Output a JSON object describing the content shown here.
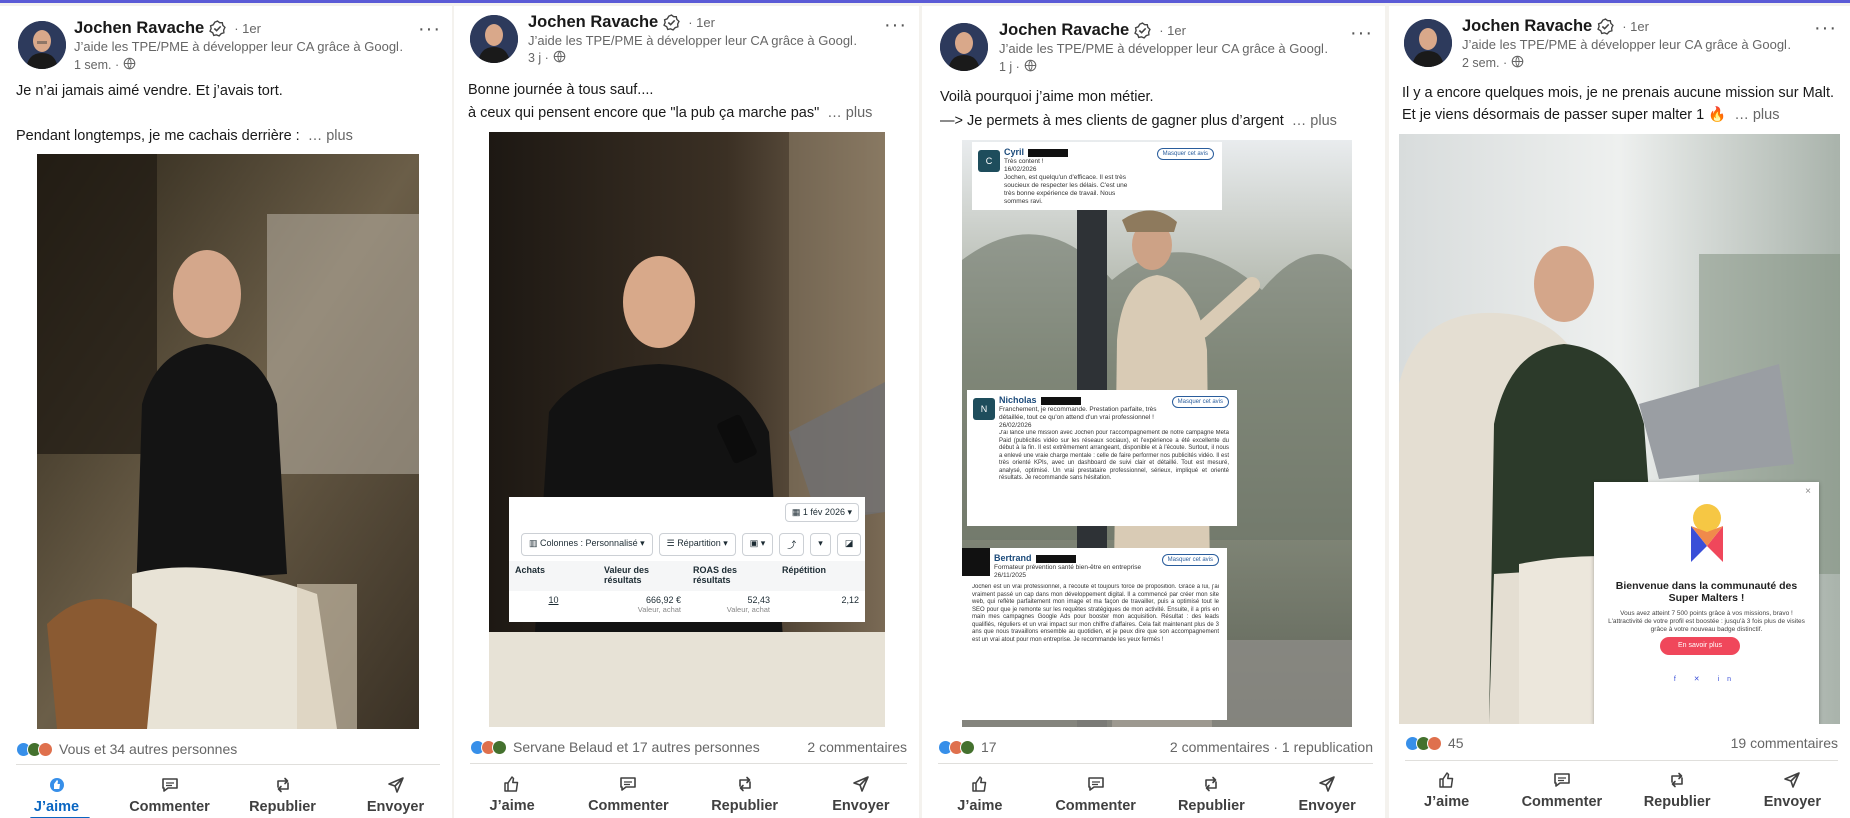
{
  "author": {
    "name": "Jochen Ravache",
    "degree": "· 1er",
    "tagline": "J’aide les TPE/PME à développer leur CA grâce à Googl…"
  },
  "more_label": "… plus",
  "actions": {
    "like": "J’aime",
    "comment": "Commenter",
    "repost": "Republier",
    "send": "Envoyer"
  },
  "colors": {
    "accent": "#0a66c2",
    "like_blue": "#378fe9"
  },
  "posts": [
    {
      "time": "1 sem. ·",
      "line1": "Je n’ai jamais aimé vendre. Et j’avais tort.",
      "line2": "Pendant longtemps, je me cachais derrière :",
      "reactions_text": "Vous et 34 autres personnes",
      "comments": "",
      "liked": true
    },
    {
      "time": "3 j ·",
      "line1": "Bonne journée à tous sauf....",
      "line2": "à ceux qui pensent encore que \"la pub ça marche pas\"",
      "reactions_text": "Servane Belaud et 17 autres personnes",
      "comments": "2 commentaires",
      "ads": {
        "date": "1 fév 2026",
        "columns_btn": "Colonnes : Personnalisé",
        "breakdown_btn": "Répartition",
        "headers": [
          "Achats",
          "Valeur des résultats",
          "ROAS des résultats",
          "Répétition"
        ],
        "values": [
          "10",
          "666,92 €",
          "52,43",
          "2,12"
        ],
        "subs": [
          "",
          "Valeur, achat",
          "Valeur, achat",
          ""
        ]
      }
    },
    {
      "time": "1 j ·",
      "line1": "Voilà pourquoi j’aime mon métier.",
      "line2": "—> Je permets à mes clients de gagner plus d’argent",
      "reactions_count": "17",
      "comments": "2 commentaires · 1 republication",
      "testimonials": [
        {
          "initial": "C",
          "name": "Cyril",
          "sub": "Très content !",
          "date": "16/02/2026",
          "body": "Jochen, est quelqu'un d'efficace. Il est très soucieux de respecter les délais. C'est une très bonne expérience de travail. Nous sommes ravi.",
          "mask": "Masquer cet avis"
        },
        {
          "initial": "N",
          "name": "Nicholas",
          "sub": "Franchement, je recommande. Prestation parfaite, très détaillée, tout ce qu'on attend d'un vrai professionnel !",
          "date": "26/02/2026",
          "body": "J'ai lancé une mission avec Jochen pour l'accompagnement de notre campagne Meta Paid (publicités vidéo sur les réseaux sociaux), et l'expérience a été excellente du début à la fin. Il est extrêmement arrangeant, disponible et à l'écoute. Surtout, il nous a enlevé une vraie charge mentale : celle de faire performer nos publicités vidéo. Il est très orienté KPIs, avec un dashboard de suivi clair et détaillé. Tout est mesuré, analysé, optimisé. Un vrai prestataire professionnel, sérieux, impliqué et orienté résultats. Je recommande sans hésitation.",
          "mask": "Masquer cet avis"
        },
        {
          "initial": "",
          "name": "Bertrand",
          "sub": "Formateur prévention santé bien-être en entreprise",
          "date": "26/11/2025",
          "body": "Jochen est un vrai professionnel, à l'écoute et toujours force de proposition. Grâce à lui, j'ai vraiment passé un cap dans mon développement digital. Il a commencé par créer mon site web, qui reflète parfaitement mon image et ma façon de travailler, puis a optimisé tout le SEO pour que je remonte sur les requêtes stratégiques de mon activité. Ensuite, il a pris en main mes campagnes Google Ads pour booster mon acquisition. Résultat : des leads qualifiés, réguliers et un vrai impact sur mon chiffre d'affaires. Cela fait maintenant plus de 3 ans que nous travaillons ensemble au quotidien, et je peux dire que son accompagnement est un vrai atout pour mon entreprise. Je recommande les yeux fermés !",
          "mask": "Masquer cet avis"
        }
      ]
    },
    {
      "time": "2 sem. ·",
      "line1": "Il y a encore quelques mois, je ne prenais aucune mission sur Malt.",
      "line2": "Et je viens désormais de passer super malter 1 🔥",
      "reactions_count": "45",
      "comments": "19 commentaires",
      "malt": {
        "title": "Bienvenue dans la communauté des Super Malters !",
        "text": "Vous avez atteint 7 500 points grâce à vos missions, bravo ! L'attractivité de votre profil est boostée : jusqu'à 3 fois plus de visites grâce à votre nouveau badge distinctif.",
        "button": "En savoir plus",
        "close": "×"
      }
    }
  ]
}
